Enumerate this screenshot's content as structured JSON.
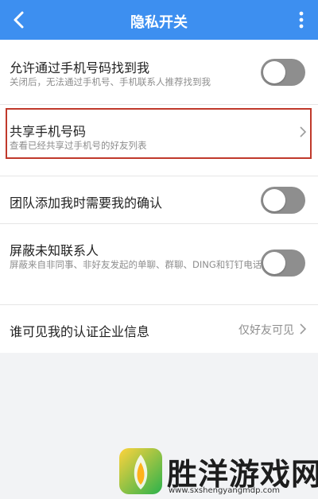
{
  "header": {
    "title": "隐私开关",
    "back_icon": "chevron-left-icon",
    "more_icon": "more-vertical-icon",
    "bg_color": "#3d8ff0"
  },
  "settings": {
    "find_by_phone": {
      "title": "允许通过手机号码找到我",
      "subtitle": "关闭后，无法通过手机号、手机联系人推荐找到我",
      "toggle_on": false
    },
    "shared_phone": {
      "title": "共享手机号码",
      "subtitle": "查看已经共享过手机号的好友列表"
    },
    "team_confirm": {
      "title": "团队添加我时需要我的确认",
      "toggle_on": false
    },
    "block_unknown": {
      "title": "屏蔽未知联系人",
      "subtitle": "屏蔽来自非同事、非好友发起的单聊、群聊、DING和钉钉电话",
      "toggle_on": false
    },
    "cert_visibility": {
      "title": "谁可见我的认证企业信息",
      "value": "仅好友可见"
    }
  },
  "highlight_color": "#c0392b",
  "watermark": {
    "text": "胜洋游戏网",
    "url": "www.sxshengyangmdp.com"
  }
}
